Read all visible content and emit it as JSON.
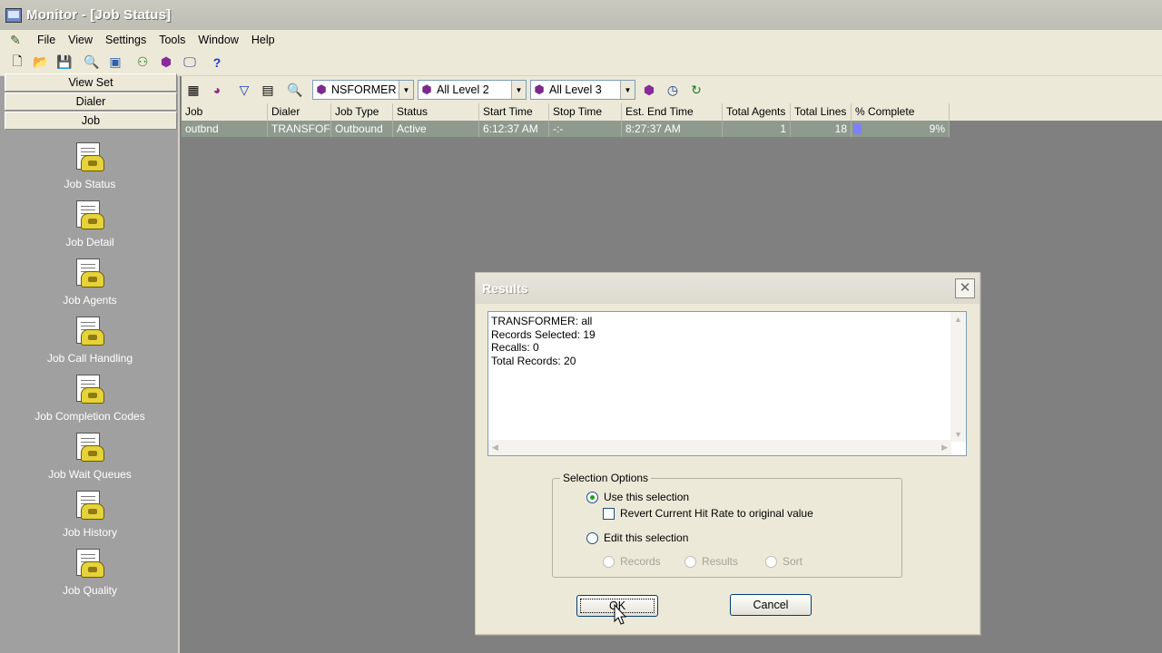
{
  "window": {
    "title": "Monitor - [Job Status]"
  },
  "menu": [
    "File",
    "View",
    "Settings",
    "Tools",
    "Window",
    "Help"
  ],
  "nav": {
    "buttons": [
      "View Set",
      "Dialer",
      "Job"
    ],
    "items": [
      "Job Status",
      "Job Detail",
      "Job Agents",
      "Job Call Handling",
      "Job Completion Codes",
      "Job Wait Queues",
      "Job History",
      "Job Quality"
    ]
  },
  "filters": {
    "combo1": "NSFORMER",
    "combo2": "All Level 2",
    "combo3": "All Level 3"
  },
  "grid": {
    "columns": [
      "Job",
      "Dialer",
      "Job Type",
      "Status",
      "Start Time",
      "Stop Time",
      "Est. End Time",
      "Total Agents",
      "Total Lines",
      "% Complete"
    ],
    "rows": [
      {
        "job": "outbnd",
        "dialer": "TRANSFOF",
        "job_type": "Outbound",
        "status": "Active",
        "start_time": "6:12:37 AM",
        "stop_time": "-:-",
        "est_end_time": "8:27:37 AM",
        "total_agents": "1",
        "total_lines": "18",
        "pct_complete": "9%",
        "pct_value": 0.09
      }
    ]
  },
  "dialog": {
    "title": "Results",
    "results_lines": [
      "TRANSFORMER: all",
      "Records Selected: 19",
      "Recalls: 0",
      "Total Records: 20"
    ],
    "group_label": "Selection Options",
    "opt_use": "Use this selection",
    "opt_revert": "Revert Current Hit Rate to original value",
    "opt_edit": "Edit this selection",
    "sub_records": "Records",
    "sub_results": "Results",
    "sub_sort": "Sort",
    "ok": "OK",
    "cancel": "Cancel"
  }
}
